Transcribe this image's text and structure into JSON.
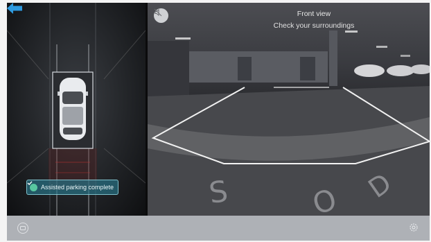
{
  "camera_view": {
    "title": "Front view",
    "hint": "Check your surroundings",
    "mute_icon": "speaker-muted-icon"
  },
  "parking": {
    "status_text": "Assisted parking complete",
    "status_icon": "checkmark-icon",
    "status_color": "#58c7a0",
    "arrow_color": "#2f9be0"
  },
  "bottom_bar": {
    "left_icon": "view-toggle-icon",
    "right_icon": "settings-gear-icon"
  },
  "colors": {
    "panel_bg": "#1b1d20",
    "bar_bg": "#aeb1b6"
  }
}
